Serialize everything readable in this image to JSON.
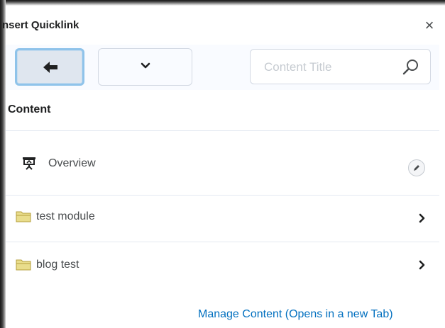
{
  "dialog": {
    "title": "nsert Quicklink",
    "close_glyph": "×"
  },
  "toolbar": {
    "back_icon": "arrow-left-icon",
    "dropdown_icon": "chevron-down-icon",
    "search_placeholder": "Content Title",
    "search_icon": "search-icon"
  },
  "section": {
    "title": "Content"
  },
  "items": [
    {
      "label": "Overview",
      "icon": "overview-easel-icon",
      "action_icon": "pencil-icon"
    },
    {
      "label": "test module",
      "icon": "folder-icon",
      "action_icon": "chevron-right-icon"
    },
    {
      "label": "blog test",
      "icon": "folder-icon",
      "action_icon": "chevron-right-icon"
    }
  ],
  "footer": {
    "manage_link": "Manage Content (Opens in a new Tab)"
  },
  "colors": {
    "link": "#006fbf",
    "focus_ring": "#8fc3ea",
    "folder": "#e9dd8c",
    "text": "#494c4e"
  }
}
